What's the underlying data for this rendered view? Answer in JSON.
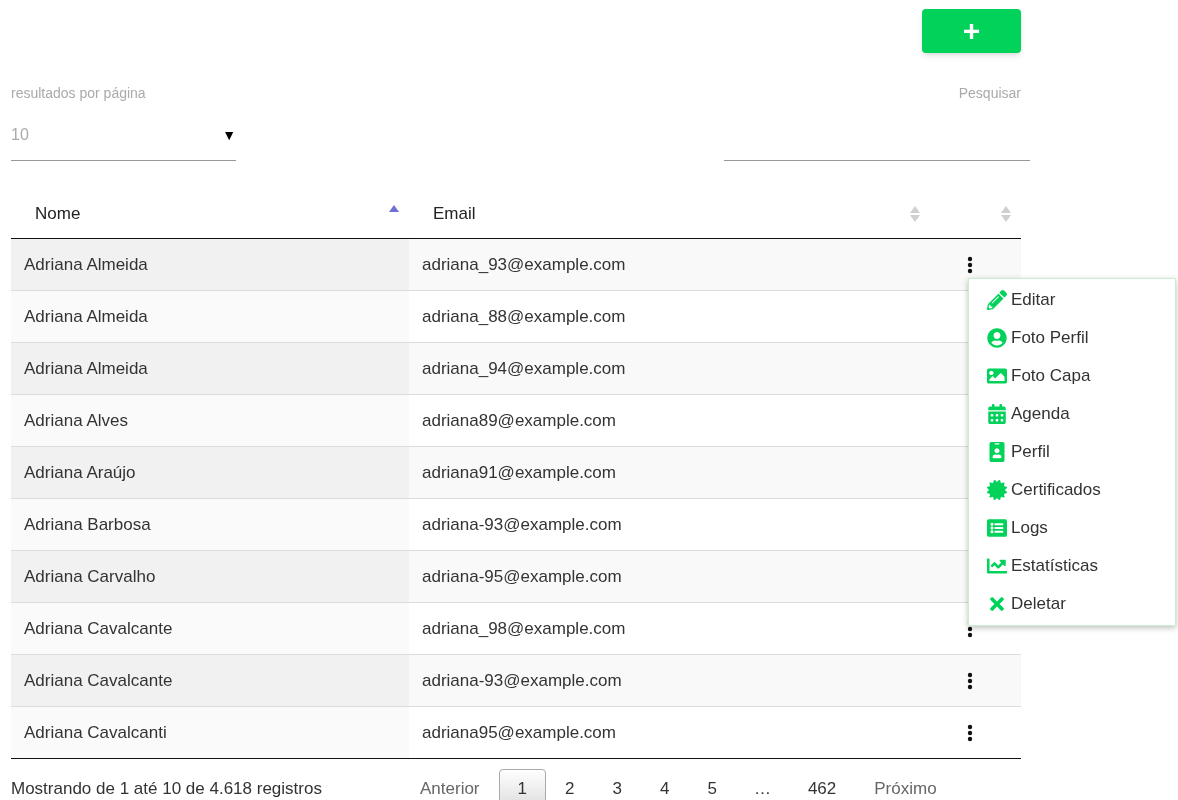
{
  "add_button": {
    "label": "+"
  },
  "page_size": {
    "label": "resultados por página",
    "value": "10",
    "caret": "▼"
  },
  "search": {
    "label": "Pesquisar"
  },
  "table": {
    "columns": [
      {
        "label": "Nome",
        "sorted": true
      },
      {
        "label": "Email",
        "sorted": false
      },
      {
        "sorted": false
      }
    ],
    "rows": [
      {
        "name": "Adriana Almeida",
        "email": "adriana_93@example.com",
        "actions_visible": true
      },
      {
        "name": "Adriana Almeida",
        "email": "adriana_88@example.com",
        "actions_visible": false
      },
      {
        "name": "Adriana Almeida",
        "email": "adriana_94@example.com",
        "actions_visible": false
      },
      {
        "name": "Adriana Alves",
        "email": "adriana89@example.com",
        "actions_visible": false
      },
      {
        "name": "Adriana Araújo",
        "email": "adriana91@example.com",
        "actions_visible": false
      },
      {
        "name": "Adriana Barbosa",
        "email": "adriana-93@example.com",
        "actions_visible": false
      },
      {
        "name": "Adriana Carvalho",
        "email": "adriana-95@example.com",
        "actions_visible": false
      },
      {
        "name": "Adriana Cavalcante",
        "email": "adriana_98@example.com",
        "actions_visible": true
      },
      {
        "name": "Adriana Cavalcante",
        "email": "adriana-93@example.com",
        "actions_visible": true
      },
      {
        "name": "Adriana Cavalcanti",
        "email": "adriana95@example.com",
        "actions_visible": true
      }
    ]
  },
  "action_menu": {
    "items": [
      {
        "label": "Editar"
      },
      {
        "label": "Foto Perfil"
      },
      {
        "label": "Foto Capa"
      },
      {
        "label": "Agenda"
      },
      {
        "label": "Perfil"
      },
      {
        "label": "Certificados"
      },
      {
        "label": "Logs"
      },
      {
        "label": "Estatísticas"
      },
      {
        "label": "Deletar"
      }
    ]
  },
  "footer": {
    "info": "Mostrando de 1 até 10 de 4.618 registros",
    "pages": [
      {
        "label": "Anterior",
        "kind": "nav",
        "selected": false
      },
      {
        "label": "1",
        "kind": "page",
        "selected": true
      },
      {
        "label": "2",
        "kind": "page",
        "selected": false
      },
      {
        "label": "3",
        "kind": "page",
        "selected": false
      },
      {
        "label": "4",
        "kind": "page",
        "selected": false
      },
      {
        "label": "5",
        "kind": "page",
        "selected": false
      },
      {
        "label": "…",
        "kind": "ellipsis",
        "selected": false
      },
      {
        "label": "462",
        "kind": "page",
        "selected": false
      },
      {
        "label": "Próximo",
        "kind": "nav",
        "selected": false
      }
    ]
  }
}
